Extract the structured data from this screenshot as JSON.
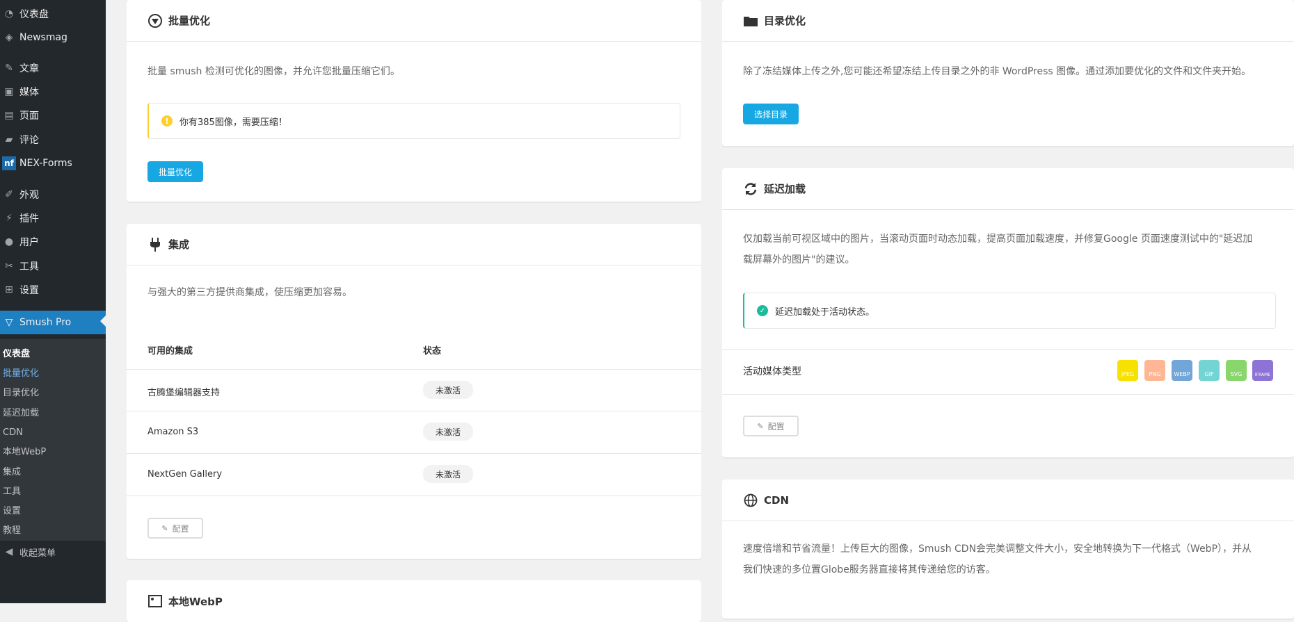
{
  "sidebar": {
    "items": [
      {
        "label": "仪表盘",
        "icon": "dashboard-icon"
      },
      {
        "label": "Newsmag",
        "icon": "newsmag-icon"
      },
      {
        "label": "文章",
        "icon": "pin-icon"
      },
      {
        "label": "媒体",
        "icon": "media-icon"
      },
      {
        "label": "页面",
        "icon": "page-icon"
      },
      {
        "label": "评论",
        "icon": "comment-icon"
      },
      {
        "label": "NEX-Forms",
        "icon": "nf-icon",
        "badge": "nf"
      },
      {
        "label": "外观",
        "icon": "brush-icon"
      },
      {
        "label": "插件",
        "icon": "plugin-icon"
      },
      {
        "label": "用户",
        "icon": "user-icon"
      },
      {
        "label": "工具",
        "icon": "wrench-icon"
      },
      {
        "label": "设置",
        "icon": "settings-icon"
      },
      {
        "label": "Smush Pro",
        "icon": "smush-icon"
      }
    ],
    "submenu": [
      "仪表盘",
      "批量优化",
      "目录优化",
      "延迟加载",
      "CDN",
      "本地WebP",
      "集成",
      "工具",
      "设置",
      "教程"
    ],
    "collapse": "收起菜单"
  },
  "bulk": {
    "title": "批量优化",
    "desc": "批量 smush 检测可优化的图像，并允许您批量压缩它们。",
    "notice": "你有385图像，需要压缩！",
    "button": "批量优化"
  },
  "integrations": {
    "title": "集成",
    "desc": "与强大的第三方提供商集成，使压缩更加容易。",
    "col_name": "可用的集成",
    "col_status": "状态",
    "rows": [
      {
        "name": "古腾堡编辑器支持",
        "status": "未激活"
      },
      {
        "name": "Amazon S3",
        "status": "未激活"
      },
      {
        "name": "NextGen Gallery",
        "status": "未激活"
      }
    ],
    "configure": "配置"
  },
  "webp": {
    "title": "本地WebP"
  },
  "directory": {
    "title": "目录优化",
    "desc": "除了冻结媒体上传之外,您可能还希望冻结上传目录之外的非 WordPress 图像。通过添加要优化的文件和文件夹开始。",
    "button": "选择目录"
  },
  "lazy": {
    "title": "延迟加载",
    "desc_line1": "仅加载当前可视区域中的图片，当滚动页面时动态加载，提高页面加载速度，并修复Google 页面速度测试中的\"延迟加",
    "desc_line2": "载屏幕外的图片\"的建议。",
    "notice": "延迟加载处于活动状态。",
    "media_label": "活动媒体类型",
    "media_types": [
      {
        "label": "JPEG",
        "color": "#f7e100"
      },
      {
        "label": "PNG",
        "color": "#ffb694"
      },
      {
        "label": "WEBP",
        "color": "#72a5d8"
      },
      {
        "label": "GIF",
        "color": "#72d5d4"
      },
      {
        "label": "SVG",
        "color": "#88d66c"
      },
      {
        "label": "IFRAME",
        "color": "#8d73d5"
      }
    ],
    "configure": "配置"
  },
  "cdn": {
    "title": "CDN",
    "desc_line1": "速度倍增和节省流量！上传巨大的图像，Smush CDN会完美调整文件大小，安全地转换为下一代格式（WebP），并从",
    "desc_line2": "我们快速的多位置Globe服务器直接将其传递给您的访客。"
  }
}
